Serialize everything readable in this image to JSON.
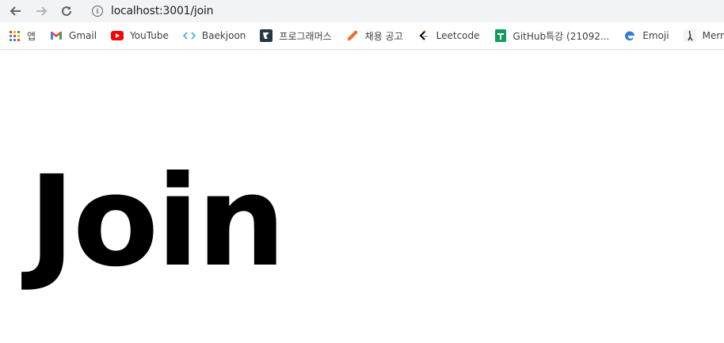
{
  "browser": {
    "url": "localhost:3001/join",
    "icons": {
      "back": "arrow-left-icon",
      "forward": "arrow-right-icon",
      "reload": "reload-icon",
      "site_info": "info-icon"
    }
  },
  "bookmarks": [
    {
      "label": "앱",
      "icon": "apps-grid-icon"
    },
    {
      "label": "Gmail",
      "icon": "gmail-icon"
    },
    {
      "label": "YouTube",
      "icon": "youtube-icon"
    },
    {
      "label": "Baekjoon",
      "icon": "code-brackets-icon"
    },
    {
      "label": "프로그래머스",
      "icon": "programmers-icon"
    },
    {
      "label": "채용 공고",
      "icon": "rocket-icon"
    },
    {
      "label": "Leetcode",
      "icon": "leetcode-icon"
    },
    {
      "label": "GitHub특강 (21092...",
      "icon": "google-sheets-icon"
    },
    {
      "label": "Emoji",
      "icon": "edge-icon"
    },
    {
      "label": "Mermaid",
      "icon": "mermaid-icon"
    }
  ],
  "page": {
    "heading": "Join"
  },
  "colors": {
    "toolbar_bg": "#f1f3f4",
    "heading": "#000000",
    "youtube_red": "#ff0000",
    "sheets_green": "#0f9d58"
  }
}
